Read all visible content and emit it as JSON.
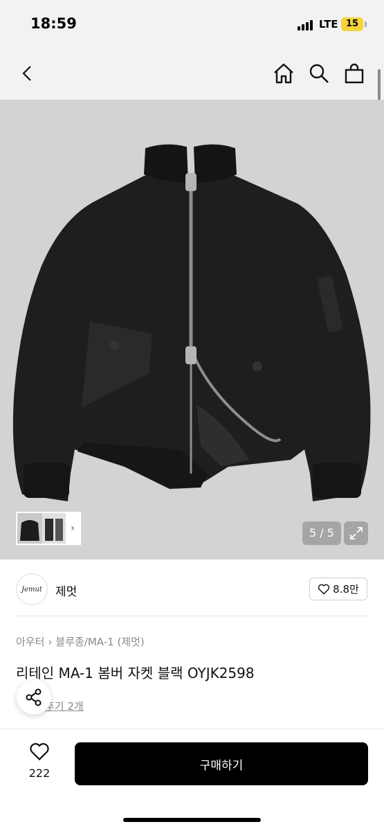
{
  "status_bar": {
    "time": "18:59",
    "network": "LTE",
    "battery": "15"
  },
  "nav": {
    "back_icon": "chevron-left-icon",
    "home_icon": "home-icon",
    "search_icon": "search-icon",
    "bag_icon": "shopping-bag-icon"
  },
  "gallery": {
    "page_counter": "5 / 5",
    "expand_icon": "expand-icon",
    "thumb_arrow": "›"
  },
  "brand": {
    "logo_text": "Jemut",
    "name": "제멋",
    "like_count": "8.8만"
  },
  "product": {
    "breadcrumb": {
      "category": "아우터",
      "separator": "›",
      "subcategory": "블루종/MA-1 (제멋)"
    },
    "title": "리테인 MA-1 봄버 자켓 블랙 OYJK2598",
    "review_label": "후기 2개"
  },
  "bottom_bar": {
    "wish_count": "222",
    "buy_label": "구매하기"
  },
  "colors": {
    "accent": "#000000",
    "battery": "#f5d33a",
    "image_bg": "#d3d3d3",
    "jacket": "#1d1d1f"
  }
}
